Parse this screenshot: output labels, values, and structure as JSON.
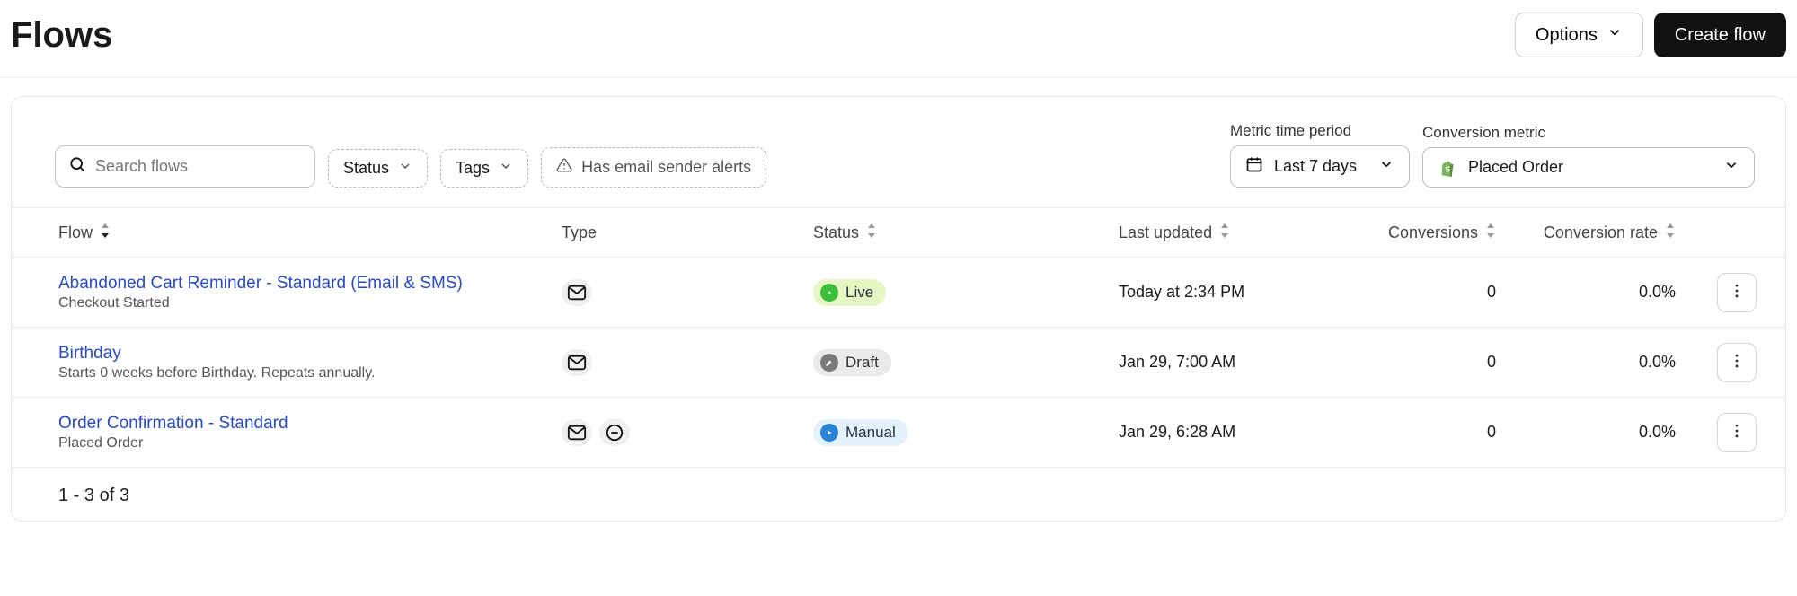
{
  "header": {
    "title": "Flows",
    "options_label": "Options",
    "create_label": "Create flow"
  },
  "filters": {
    "search_placeholder": "Search flows",
    "status_label": "Status",
    "tags_label": "Tags",
    "alert_label": "Has email sender alerts",
    "metric_period": {
      "label": "Metric time period",
      "value": "Last 7 days"
    },
    "conversion_metric": {
      "label": "Conversion metric",
      "value": "Placed Order"
    }
  },
  "columns": {
    "flow": "Flow",
    "type": "Type",
    "status": "Status",
    "last_updated": "Last updated",
    "conversions": "Conversions",
    "conversion_rate": "Conversion rate"
  },
  "rows": [
    {
      "name": "Abandoned Cart Reminder - Standard (Email & SMS)",
      "subtitle": "Checkout Started",
      "type_icons": [
        "email"
      ],
      "status": "Live",
      "status_kind": "live",
      "last_updated": "Today at 2:34 PM",
      "conversions": "0",
      "conversion_rate": "0.0%"
    },
    {
      "name": "Birthday",
      "subtitle": "Starts 0 weeks before Birthday. Repeats annually.",
      "type_icons": [
        "email"
      ],
      "status": "Draft",
      "status_kind": "draft",
      "last_updated": "Jan 29, 7:00 AM",
      "conversions": "0",
      "conversion_rate": "0.0%"
    },
    {
      "name": "Order Confirmation - Standard",
      "subtitle": "Placed Order",
      "type_icons": [
        "email",
        "sms"
      ],
      "status": "Manual",
      "status_kind": "manual",
      "last_updated": "Jan 29, 6:28 AM",
      "conversions": "0",
      "conversion_rate": "0.0%"
    }
  ],
  "pagination": "1 - 3 of 3"
}
